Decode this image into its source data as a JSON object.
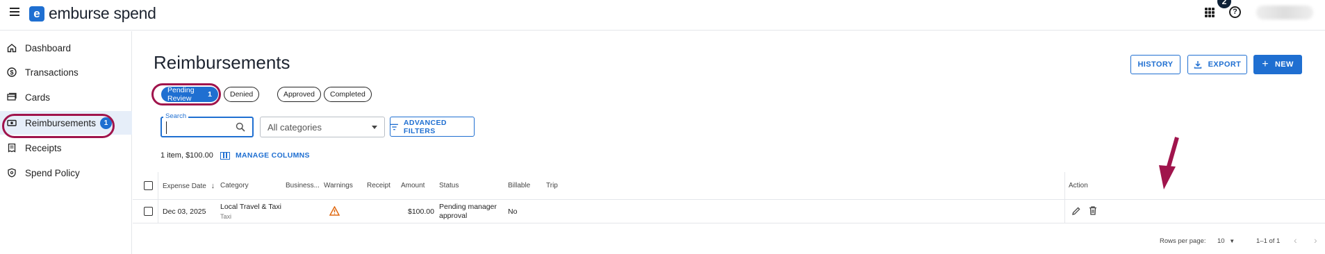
{
  "brand": {
    "name": "emburse spend",
    "logo_letter": "e",
    "accent": "#1f6fd1",
    "highlight": "#a0144c"
  },
  "topbar": {
    "notifications_count": "2",
    "help_glyph": "?"
  },
  "sidebar": {
    "items": [
      {
        "label": "Dashboard",
        "icon": "home-icon"
      },
      {
        "label": "Transactions",
        "icon": "dollar-circle-icon"
      },
      {
        "label": "Cards",
        "icon": "cards-icon"
      },
      {
        "label": "Reimbursements",
        "icon": "cash-icon",
        "badge": "1",
        "active": true
      },
      {
        "label": "Receipts",
        "icon": "receipt-icon"
      },
      {
        "label": "Spend Policy",
        "icon": "shield-icon"
      }
    ]
  },
  "page": {
    "title": "Reimbursements",
    "actions": {
      "history": "HISTORY",
      "export": "EXPORT",
      "new": "NEW"
    },
    "tabs": [
      {
        "label": "Pending Review",
        "count": "1",
        "active": true
      },
      {
        "label": "Denied"
      },
      {
        "label": "Approved"
      },
      {
        "label": "Completed"
      }
    ],
    "filters": {
      "search_label": "Search",
      "search_value": "",
      "category_select": "All categories",
      "advanced_filters": "ADVANCED FILTERS"
    },
    "summary": "1 item, $100.00",
    "manage_columns": "MANAGE COLUMNS"
  },
  "table": {
    "columns": [
      "Expense Date",
      "Category",
      "Business...",
      "Warnings",
      "Receipt",
      "Amount",
      "Status",
      "Billable",
      "Trip",
      "Action"
    ],
    "sort": {
      "column": "Expense Date",
      "direction": "desc"
    },
    "rows": [
      {
        "expense_date": "Dec 03, 2025",
        "category": "Local Travel & Taxi",
        "category_sub": "Taxi",
        "warning": "warning-icon",
        "amount": "$100.00",
        "status_line1": "Pending manager",
        "status_line2": "approval",
        "billable": "No"
      }
    ]
  },
  "pagination": {
    "rows_per_page_label": "Rows per page:",
    "rows_per_page": "10",
    "range": "1–1 of 1"
  }
}
